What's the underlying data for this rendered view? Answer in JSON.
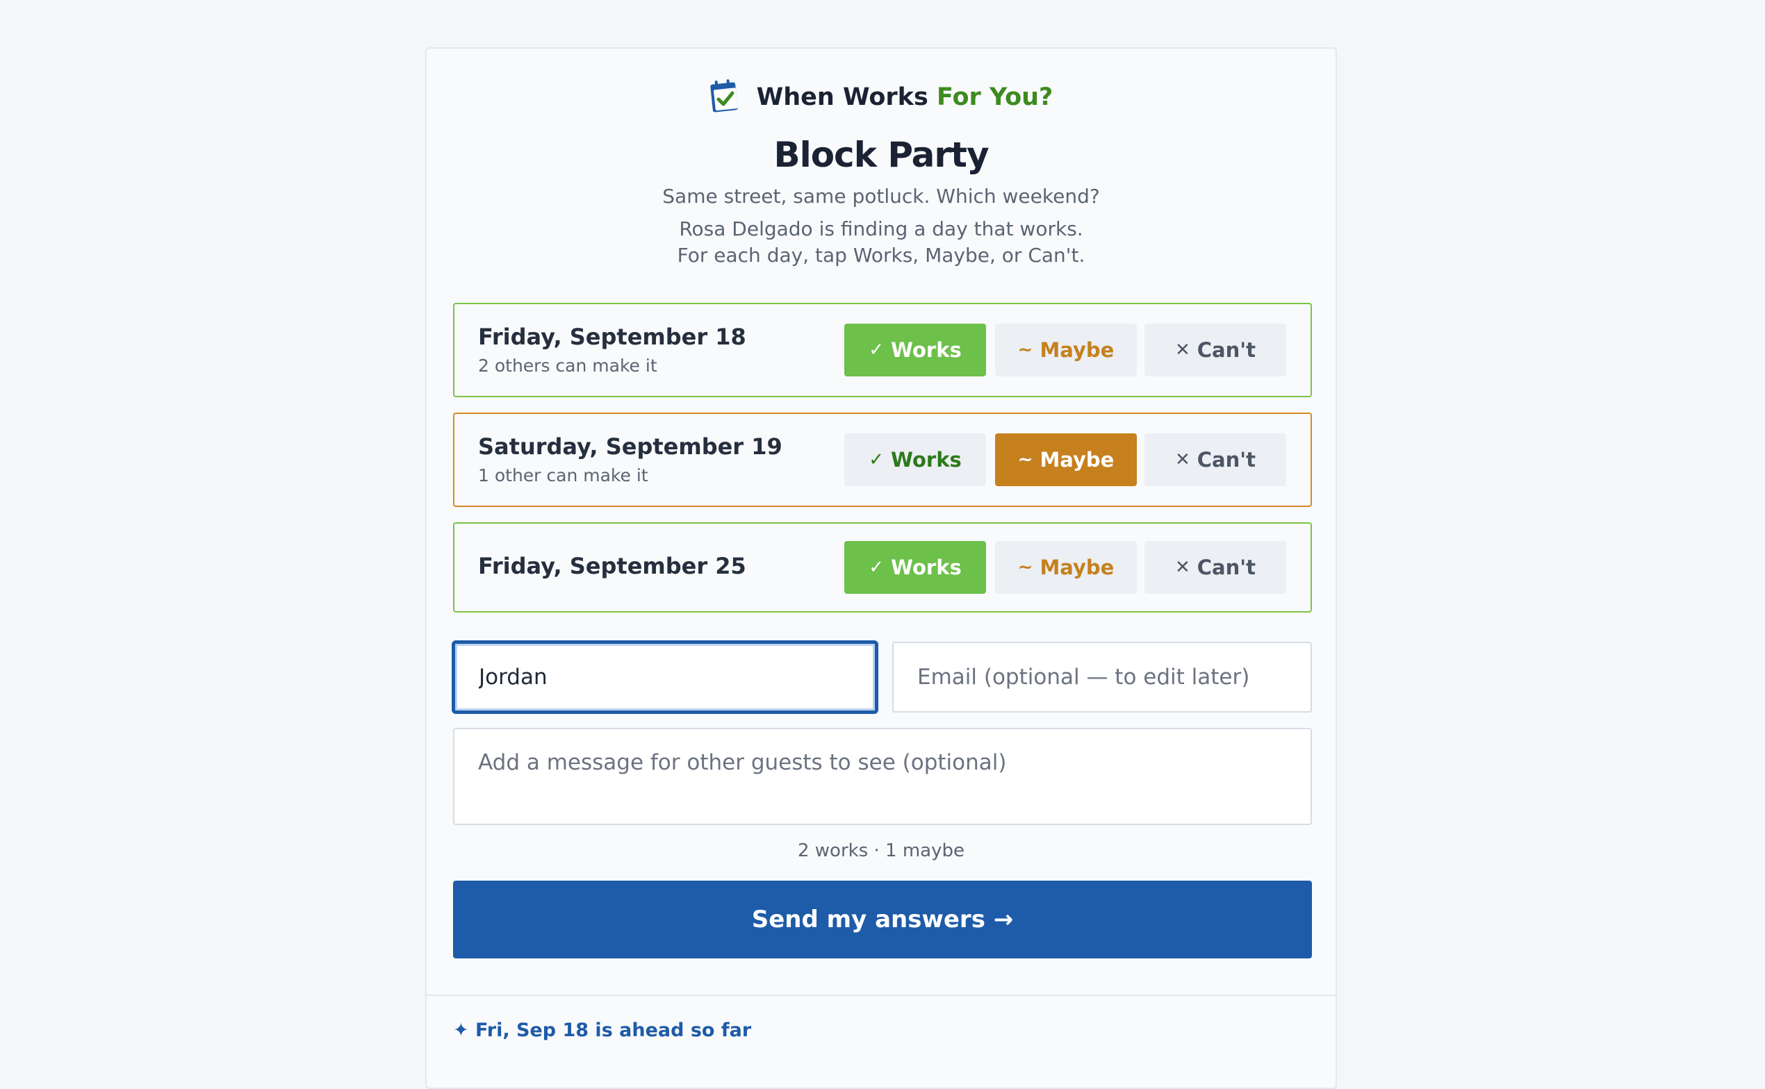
{
  "brand": {
    "name": "When Works",
    "accent": "For You?",
    "icon": "calendar-check-icon",
    "accent_color": "#3d8b1f"
  },
  "event": {
    "title": "Block Party",
    "subtitle": "Same street, same potluck. Which weekend?",
    "intro_line1": "Rosa Delgado is finding a day that works.",
    "intro_line2": "For each day, tap Works, Maybe, or Can't."
  },
  "buttons": {
    "works": "Works",
    "maybe": "Maybe",
    "cant": "Can't",
    "works_icon": "✓",
    "maybe_icon": "~",
    "cant_icon": "✕"
  },
  "days": [
    {
      "name": "Friday, September 18",
      "count": "2 others can make it",
      "selected": "works"
    },
    {
      "name": "Saturday, September 19",
      "count": "1 other can make it",
      "selected": "maybe"
    },
    {
      "name": "Friday, September 25",
      "count": "",
      "selected": "works"
    }
  ],
  "form": {
    "name_value": "Jordan",
    "email_placeholder": "Email (optional — to edit later)",
    "message_placeholder": "Add a message for other guests to see (optional)"
  },
  "tally": "2 works · 1 maybe",
  "send_label": "Send my answers →",
  "leader": {
    "icon": "sparkle-icon",
    "glyph": "✦",
    "text": "Fri, Sep 18 is ahead so far"
  },
  "colors": {
    "works": "#6dc04a",
    "maybe": "#c6801e",
    "primary": "#1e5ba8"
  }
}
